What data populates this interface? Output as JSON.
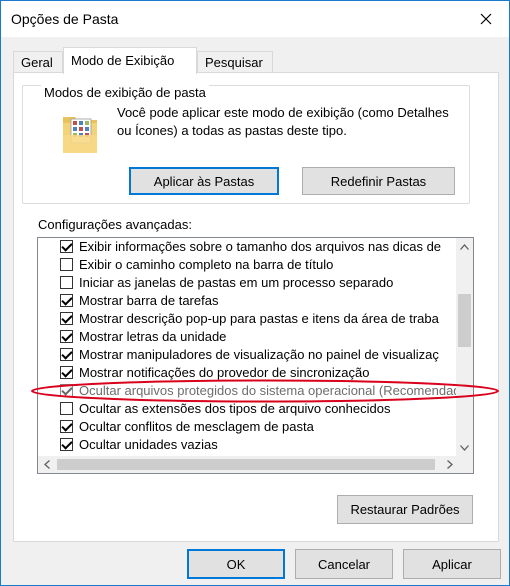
{
  "window": {
    "title": "Opções de Pasta"
  },
  "tabs": [
    {
      "label": "Geral"
    },
    {
      "label": "Modo de Exibição"
    },
    {
      "label": "Pesquisar"
    }
  ],
  "folder_views": {
    "legend": "Modos de exibição de pasta",
    "description": "Você pode aplicar este modo de exibição (como Detalhes ou Ícones) a todas as pastas deste tipo.",
    "apply_button": "Aplicar às Pastas",
    "reset_button": "Redefinir Pastas"
  },
  "advanced": {
    "label": "Configurações avançadas:",
    "items": [
      {
        "label": "Exibir informações sobre o tamanho dos arquivos nas dicas de",
        "checked": true
      },
      {
        "label": "Exibir o caminho completo na barra de título",
        "checked": false
      },
      {
        "label": "Iniciar as janelas de pastas em um processo separado",
        "checked": false
      },
      {
        "label": "Mostrar barra de tarefas",
        "checked": true
      },
      {
        "label": "Mostrar descrição pop-up para pastas e itens da área de traba",
        "checked": true
      },
      {
        "label": "Mostrar letras da unidade",
        "checked": true
      },
      {
        "label": "Mostrar manipuladores de visualização no painel de visualizaç",
        "checked": true
      },
      {
        "label": "Mostrar notificações do provedor de sincronização",
        "checked": true
      },
      {
        "label": "Ocultar arquivos protegidos do sistema operacional (Recomendado)",
        "checked": true
      },
      {
        "label": "Ocultar as extensões dos tipos de arquivo conhecidos",
        "checked": false
      },
      {
        "label": "Ocultar conflitos de mesclagem de pasta",
        "checked": true
      },
      {
        "label": "Ocultar unidades vazias",
        "checked": true
      }
    ],
    "restore_button": "Restaurar Padrões"
  },
  "footer": {
    "ok": "OK",
    "cancel": "Cancelar",
    "apply": "Aplicar"
  },
  "colors": {
    "accent": "#0078d7",
    "highlight_ring": "#d9001b"
  }
}
